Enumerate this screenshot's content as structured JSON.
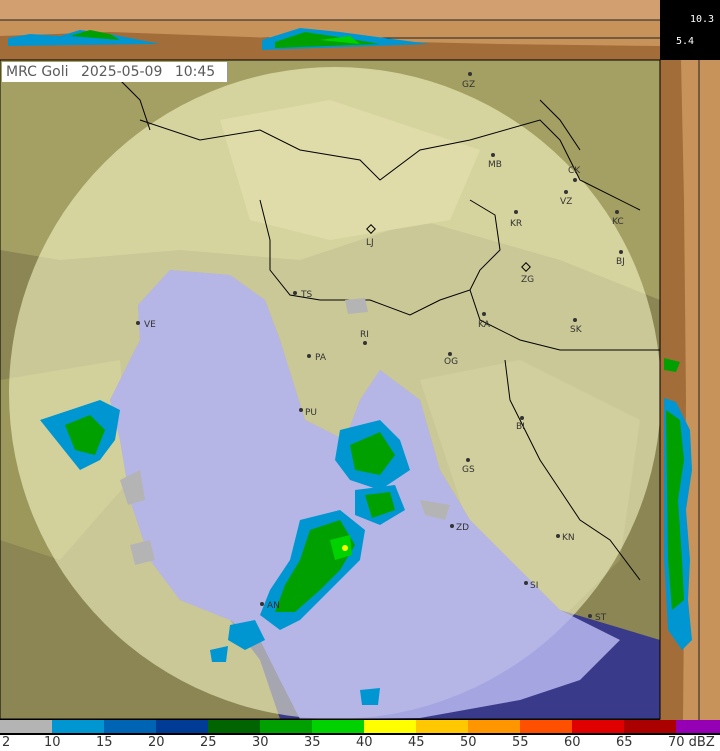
{
  "header": {
    "station": "MRC Goli",
    "date": "2025-05-09",
    "time": "10:45"
  },
  "height_labels": {
    "top": "10.3",
    "mid": "5.4"
  },
  "cities": [
    {
      "code": "GZ"
    },
    {
      "code": "MB"
    },
    {
      "code": "CK"
    },
    {
      "code": "VZ"
    },
    {
      "code": "KR"
    },
    {
      "code": "KC"
    },
    {
      "code": "LJ"
    },
    {
      "code": "ZG"
    },
    {
      "code": "BJ"
    },
    {
      "code": "TS"
    },
    {
      "code": "KA"
    },
    {
      "code": "SK"
    },
    {
      "code": "VE"
    },
    {
      "code": "RI"
    },
    {
      "code": "PA"
    },
    {
      "code": "OG"
    },
    {
      "code": "PU"
    },
    {
      "code": "BI"
    },
    {
      "code": "GS"
    },
    {
      "code": "ZD"
    },
    {
      "code": "KN"
    },
    {
      "code": "SI"
    },
    {
      "code": "AN"
    },
    {
      "code": "ST"
    }
  ],
  "legend": {
    "unit": "dBZ",
    "ticks": [
      "2",
      "10",
      "15",
      "20",
      "25",
      "30",
      "35",
      "40",
      "45",
      "50",
      "55",
      "60",
      "65",
      "70 dBZ"
    ],
    "colors": [
      "#b4b4b4",
      "#0096d2",
      "#0064b4",
      "#003c96",
      "#006400",
      "#00a000",
      "#00d200",
      "#ffff00",
      "#ffc800",
      "#ff9600",
      "#ff5000",
      "#e10000",
      "#aa0000",
      "#9600b4"
    ]
  }
}
